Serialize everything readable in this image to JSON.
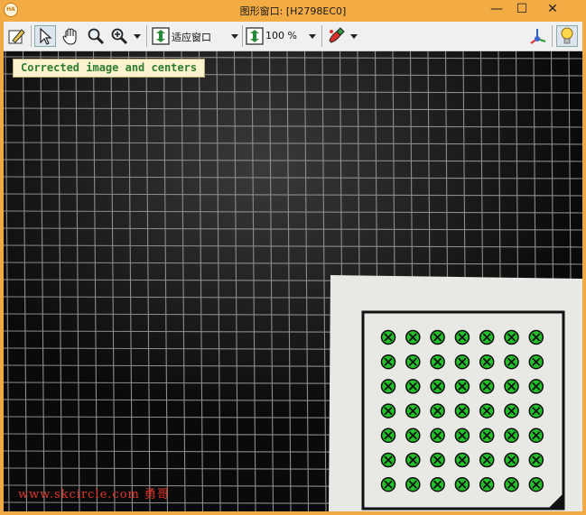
{
  "window": {
    "title": "图形窗口: [H2798EC0]",
    "app_icon_text": "HA",
    "minimize": "—",
    "maximize": "☐",
    "close": "✕"
  },
  "toolbar": {
    "zoom_mode_label": "适应窗口",
    "zoom_percent_label": "100 %"
  },
  "canvas": {
    "overlay_text": "Corrected image and centers",
    "watermark": "www.skcircle.com 勇哥",
    "calibration_grid": {
      "rows": 7,
      "cols": 7
    }
  },
  "colors": {
    "title_bar": "#f3ab44",
    "marker_fill": "#22c12a",
    "overlay_text": "#2e7d2e",
    "watermark": "#e0352a"
  }
}
